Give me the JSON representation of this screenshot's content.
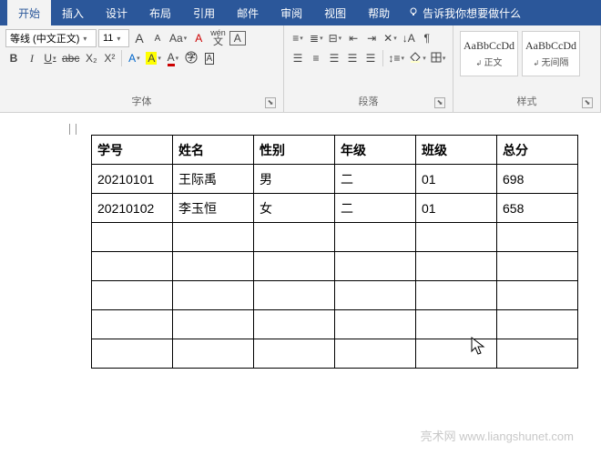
{
  "tabs": {
    "items": [
      {
        "label": "开始",
        "active": true
      },
      {
        "label": "插入",
        "active": false
      },
      {
        "label": "设计",
        "active": false
      },
      {
        "label": "布局",
        "active": false
      },
      {
        "label": "引用",
        "active": false
      },
      {
        "label": "邮件",
        "active": false
      },
      {
        "label": "审阅",
        "active": false
      },
      {
        "label": "视图",
        "active": false
      },
      {
        "label": "帮助",
        "active": false
      }
    ],
    "tell_me": "告诉我你想要做什么"
  },
  "ribbon": {
    "font": {
      "label": "字体",
      "font_name": "等线 (中文正文)",
      "font_size": "11",
      "grow": "A",
      "shrink": "A",
      "case": "Aa",
      "clear": "A",
      "phonetic": "wén",
      "charborder": "A",
      "bold": "B",
      "italic": "I",
      "underline": "U",
      "strike": "abc",
      "sub": "X₂",
      "sup": "X²",
      "texteffect": "A",
      "highlight": "A",
      "fontcolor": "A"
    },
    "paragraph": {
      "label": "段落"
    },
    "styles": {
      "label": "样式",
      "items": [
        {
          "preview": "AaBbCcDd",
          "name": "正文"
        },
        {
          "preview": "AaBbCcDd",
          "name": "无间隔"
        }
      ]
    }
  },
  "document": {
    "table": {
      "header": [
        "学号",
        "姓名",
        "性别",
        "年级",
        "班级",
        "总分"
      ],
      "rows": [
        [
          "20210101",
          "王际禹",
          "男",
          "二",
          "01",
          "698"
        ],
        [
          "20210102",
          "李玉恒",
          "女",
          "二",
          "01",
          "658"
        ],
        [
          "",
          "",
          "",
          "",
          "",
          ""
        ],
        [
          "",
          "",
          "",
          "",
          "",
          ""
        ],
        [
          "",
          "",
          "",
          "",
          "",
          ""
        ],
        [
          "",
          "",
          "",
          "",
          "",
          ""
        ],
        [
          "",
          "",
          "",
          "",
          "",
          ""
        ]
      ]
    }
  },
  "watermark": "亮术网 www.liangshunet.com"
}
